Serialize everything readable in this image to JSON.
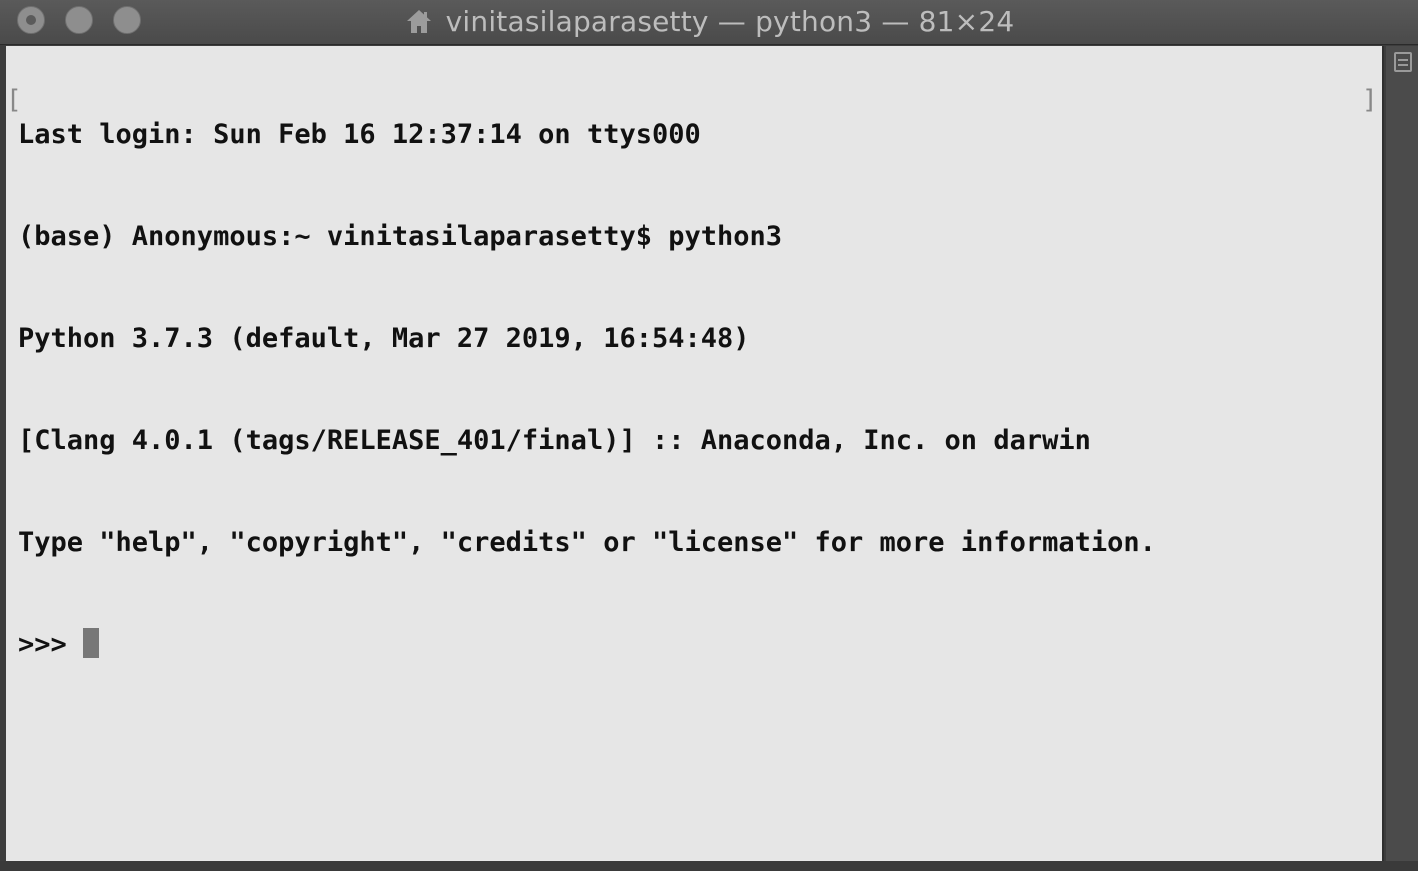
{
  "window": {
    "title": "vinitasilaparasetty — python3 — 81×24",
    "title_icon": "home-icon"
  },
  "terminal": {
    "lines": [
      "Last login: Sun Feb 16 12:37:14 on ttys000",
      "(base) Anonymous:~ vinitasilaparasetty$ python3",
      "Python 3.7.3 (default, Mar 27 2019, 16:54:48)",
      "[Clang 4.0.1 (tags/RELEASE_401/final)] :: Anaconda, Inc. on darwin",
      "Type \"help\", \"copyright\", \"credits\" or \"license\" for more information."
    ],
    "prompt": ">>> ",
    "mark_left": "[",
    "mark_right": "]"
  },
  "colors": {
    "terminal_bg": "#e6e6e6",
    "text": "#111111",
    "chrome": "#4a4a4a"
  }
}
